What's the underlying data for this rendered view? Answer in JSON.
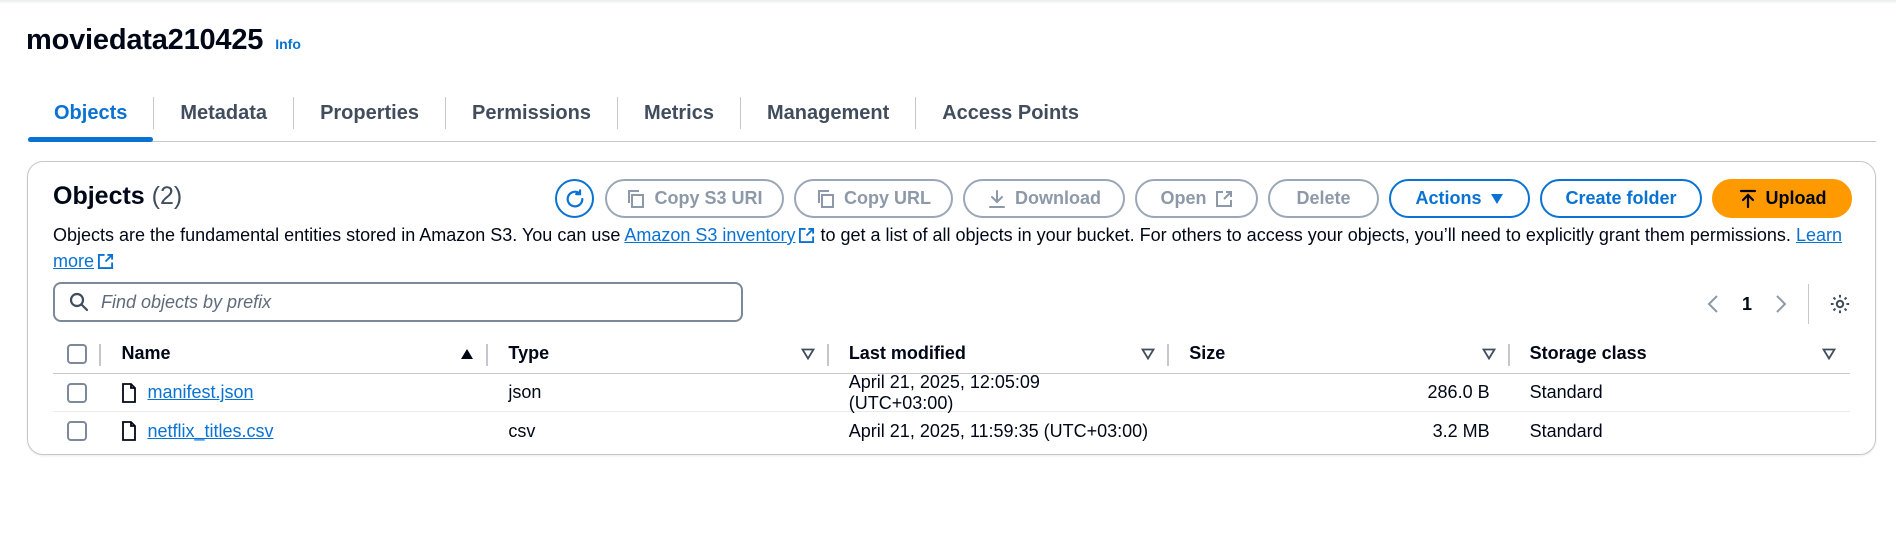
{
  "header": {
    "bucket_name": "moviedata210425",
    "info_label": "Info"
  },
  "tabs": [
    {
      "label": "Objects",
      "active": true
    },
    {
      "label": "Metadata"
    },
    {
      "label": "Properties"
    },
    {
      "label": "Permissions"
    },
    {
      "label": "Metrics"
    },
    {
      "label": "Management"
    },
    {
      "label": "Access Points"
    }
  ],
  "objects_panel": {
    "title": "Objects",
    "count": "(2)",
    "buttons": {
      "copy_s3_uri": "Copy S3 URI",
      "copy_url": "Copy URL",
      "download": "Download",
      "open": "Open",
      "delete": "Delete",
      "actions": "Actions",
      "create_folder": "Create folder",
      "upload": "Upload"
    },
    "description": {
      "part1": "Objects are the fundamental entities stored in Amazon S3. You can use ",
      "inventory_link": "Amazon S3 inventory",
      "part2": " to get a list of all objects in your bucket. For others to access your objects, you’ll need to explicitly grant them permissions. ",
      "learn_more": "Learn more"
    },
    "search": {
      "placeholder": "Find objects by prefix"
    },
    "pagination": {
      "current_page": "1"
    }
  },
  "table": {
    "columns": {
      "name": "Name",
      "type": "Type",
      "last_modified": "Last modified",
      "size": "Size",
      "storage_class": "Storage class"
    },
    "rows": [
      {
        "name": "manifest.json",
        "type": "json",
        "last_modified": "April 21, 2025, 12:05:09 (UTC+03:00)",
        "size": "286.0 B",
        "storage_class": "Standard"
      },
      {
        "name": "netflix_titles.csv",
        "type": "csv",
        "last_modified": "April 21, 2025, 11:59:35 (UTC+03:00)",
        "size": "3.2 MB",
        "storage_class": "Standard"
      }
    ]
  },
  "colors": {
    "accent": "#0972d3",
    "upload": "#ff9900",
    "disabled": "#8d99a8",
    "text": "#000716"
  }
}
